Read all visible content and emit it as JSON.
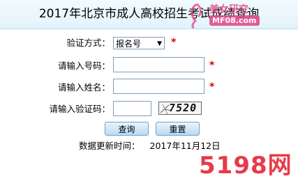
{
  "title": "2017年北京市成人高校招生考试成绩查询",
  "watermarks": {
    "top_brand": "美女研究",
    "top_site": "MF08.com",
    "bottom_brand": "5198网"
  },
  "form": {
    "verify_method_label": "验证方式：",
    "verify_method_value": "报名号",
    "number_label": "请输入号码：",
    "name_label": "请输入姓名：",
    "captcha_label": "请输入验证码：",
    "captcha_text": "7520",
    "required_mark": "*"
  },
  "buttons": {
    "query": "查询",
    "reset": "重置"
  },
  "update": {
    "label": "数据更新时间：",
    "date": "2017年11月12日"
  },
  "colors": {
    "required": "#d40000",
    "brand": "#e83a4a",
    "button_border": "#6ca3c7"
  }
}
